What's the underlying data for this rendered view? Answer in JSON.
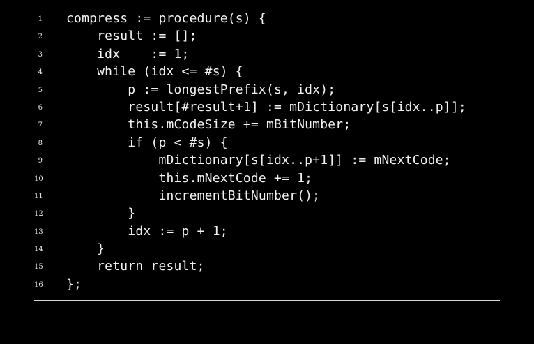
{
  "listing": {
    "lines": [
      {
        "number": "1",
        "code": "compress := procedure(s) {"
      },
      {
        "number": "2",
        "code": "    result := [];"
      },
      {
        "number": "3",
        "code": "    idx    := 1;"
      },
      {
        "number": "4",
        "code": "    while (idx <= #s) {"
      },
      {
        "number": "5",
        "code": "        p := longestPrefix(s, idx);"
      },
      {
        "number": "6",
        "code": "        result[#result+1] := mDictionary[s[idx..p]];"
      },
      {
        "number": "7",
        "code": "        this.mCodeSize += mBitNumber;"
      },
      {
        "number": "8",
        "code": "        if (p < #s) {"
      },
      {
        "number": "9",
        "code": "            mDictionary[s[idx..p+1]] := mNextCode;"
      },
      {
        "number": "10",
        "code": "            this.mNextCode += 1;"
      },
      {
        "number": "11",
        "code": "            incrementBitNumber();"
      },
      {
        "number": "12",
        "code": "        }"
      },
      {
        "number": "13",
        "code": "        idx := p + 1;"
      },
      {
        "number": "14",
        "code": "    }"
      },
      {
        "number": "15",
        "code": "    return result;"
      },
      {
        "number": "16",
        "code": "};"
      }
    ]
  },
  "colors": {
    "background": "#000000",
    "text": "#f2f2f2",
    "rule": "#d8d8d8"
  }
}
